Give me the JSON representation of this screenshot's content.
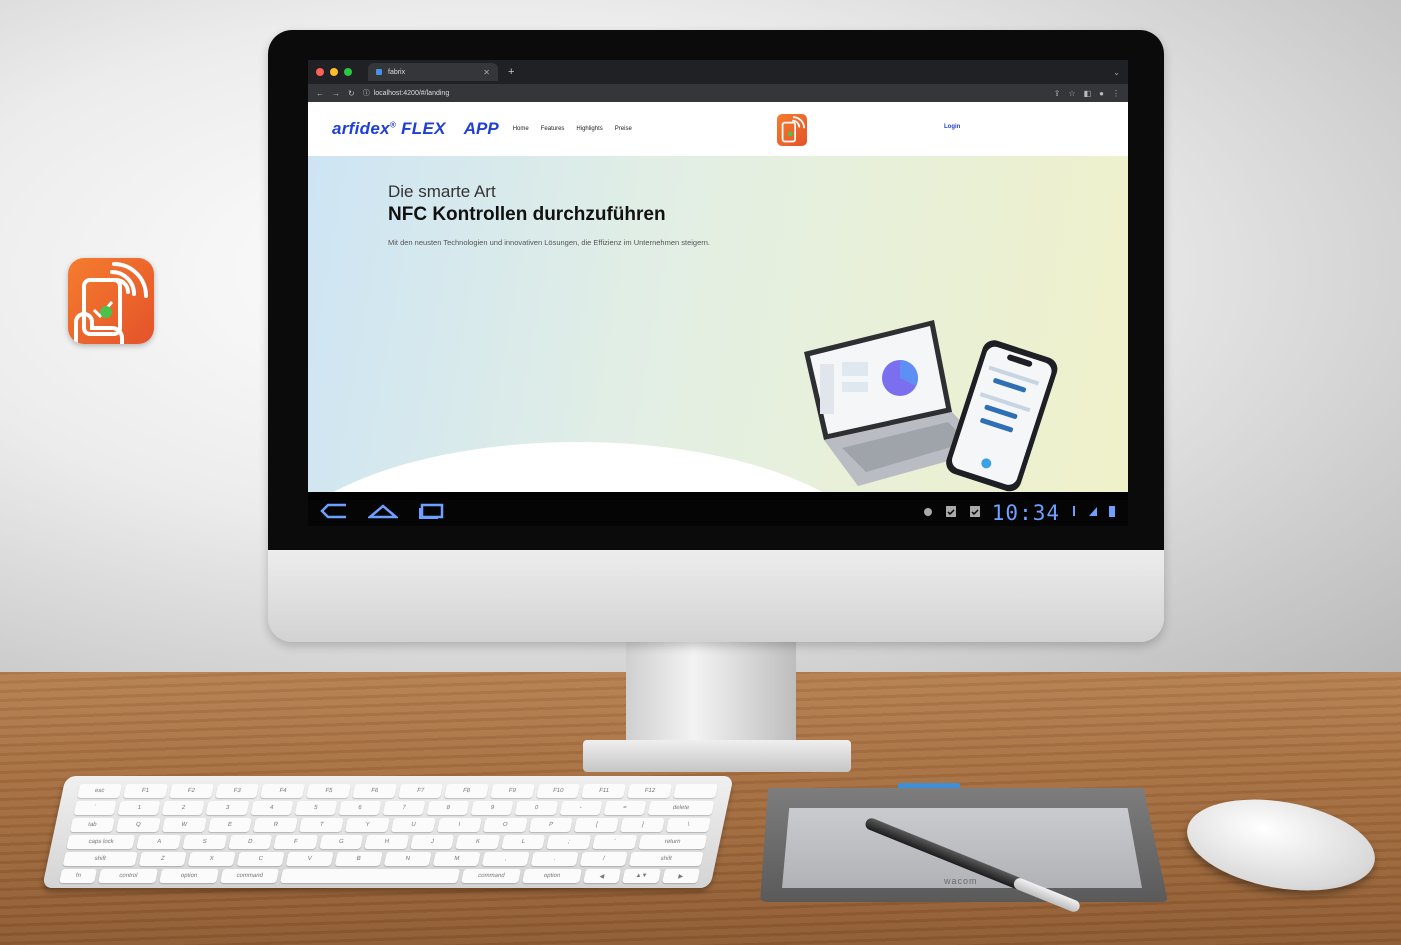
{
  "browser": {
    "tab_title": "fabrix",
    "new_tab_symbol": "+",
    "url": "localhost:4200/#/landing"
  },
  "site": {
    "brand_name": "arfidex",
    "brand_reg": "®",
    "brand_flex": "FLEX",
    "brand_app": "APP",
    "nav": [
      "Home",
      "Features",
      "Highlights",
      "Preise"
    ],
    "login_label": "Login"
  },
  "hero": {
    "subtitle": "Die smarte Art",
    "title": "NFC Kontrollen durchzuführen",
    "text": "Mit den neusten Technologien und innovativen Lösungen, die Effizienz im Unternehmen steigern."
  },
  "system_bar": {
    "clock": "10:34"
  },
  "tablet": {
    "logo": "wacom"
  },
  "keyboard": {
    "rows": [
      [
        "esc",
        "F1",
        "F2",
        "F3",
        "F4",
        "F5",
        "F6",
        "F7",
        "F8",
        "F9",
        "F10",
        "F11",
        "F12",
        ""
      ],
      [
        "`",
        "1",
        "2",
        "3",
        "4",
        "5",
        "6",
        "7",
        "8",
        "9",
        "0",
        "-",
        "=",
        "delete"
      ],
      [
        "tab",
        "Q",
        "W",
        "E",
        "R",
        "T",
        "Y",
        "U",
        "I",
        "O",
        "P",
        "[",
        "]",
        "\\"
      ],
      [
        "caps lock",
        "A",
        "S",
        "D",
        "F",
        "G",
        "H",
        "J",
        "K",
        "L",
        ";",
        "'",
        "return"
      ],
      [
        "shift",
        "Z",
        "X",
        "C",
        "V",
        "B",
        "N",
        "M",
        ",",
        ".",
        "/",
        "shift"
      ],
      [
        "fn",
        "control",
        "option",
        "command",
        "",
        "command",
        "option",
        "◀",
        "▲▼",
        "▶"
      ]
    ]
  },
  "colors": {
    "brand_blue": "#1f3fd6",
    "app_orange": "#f57c2e",
    "clock_blue": "#6fa0ff",
    "tablet_accent": "#3f8fd8"
  },
  "icons": [
    "nfc-hand-phone-icon",
    "back-icon",
    "home-icon",
    "recent-apps-icon",
    "android-icon",
    "clipboard-icon",
    "wifi-icon",
    "signal-icon",
    "battery-icon"
  ]
}
